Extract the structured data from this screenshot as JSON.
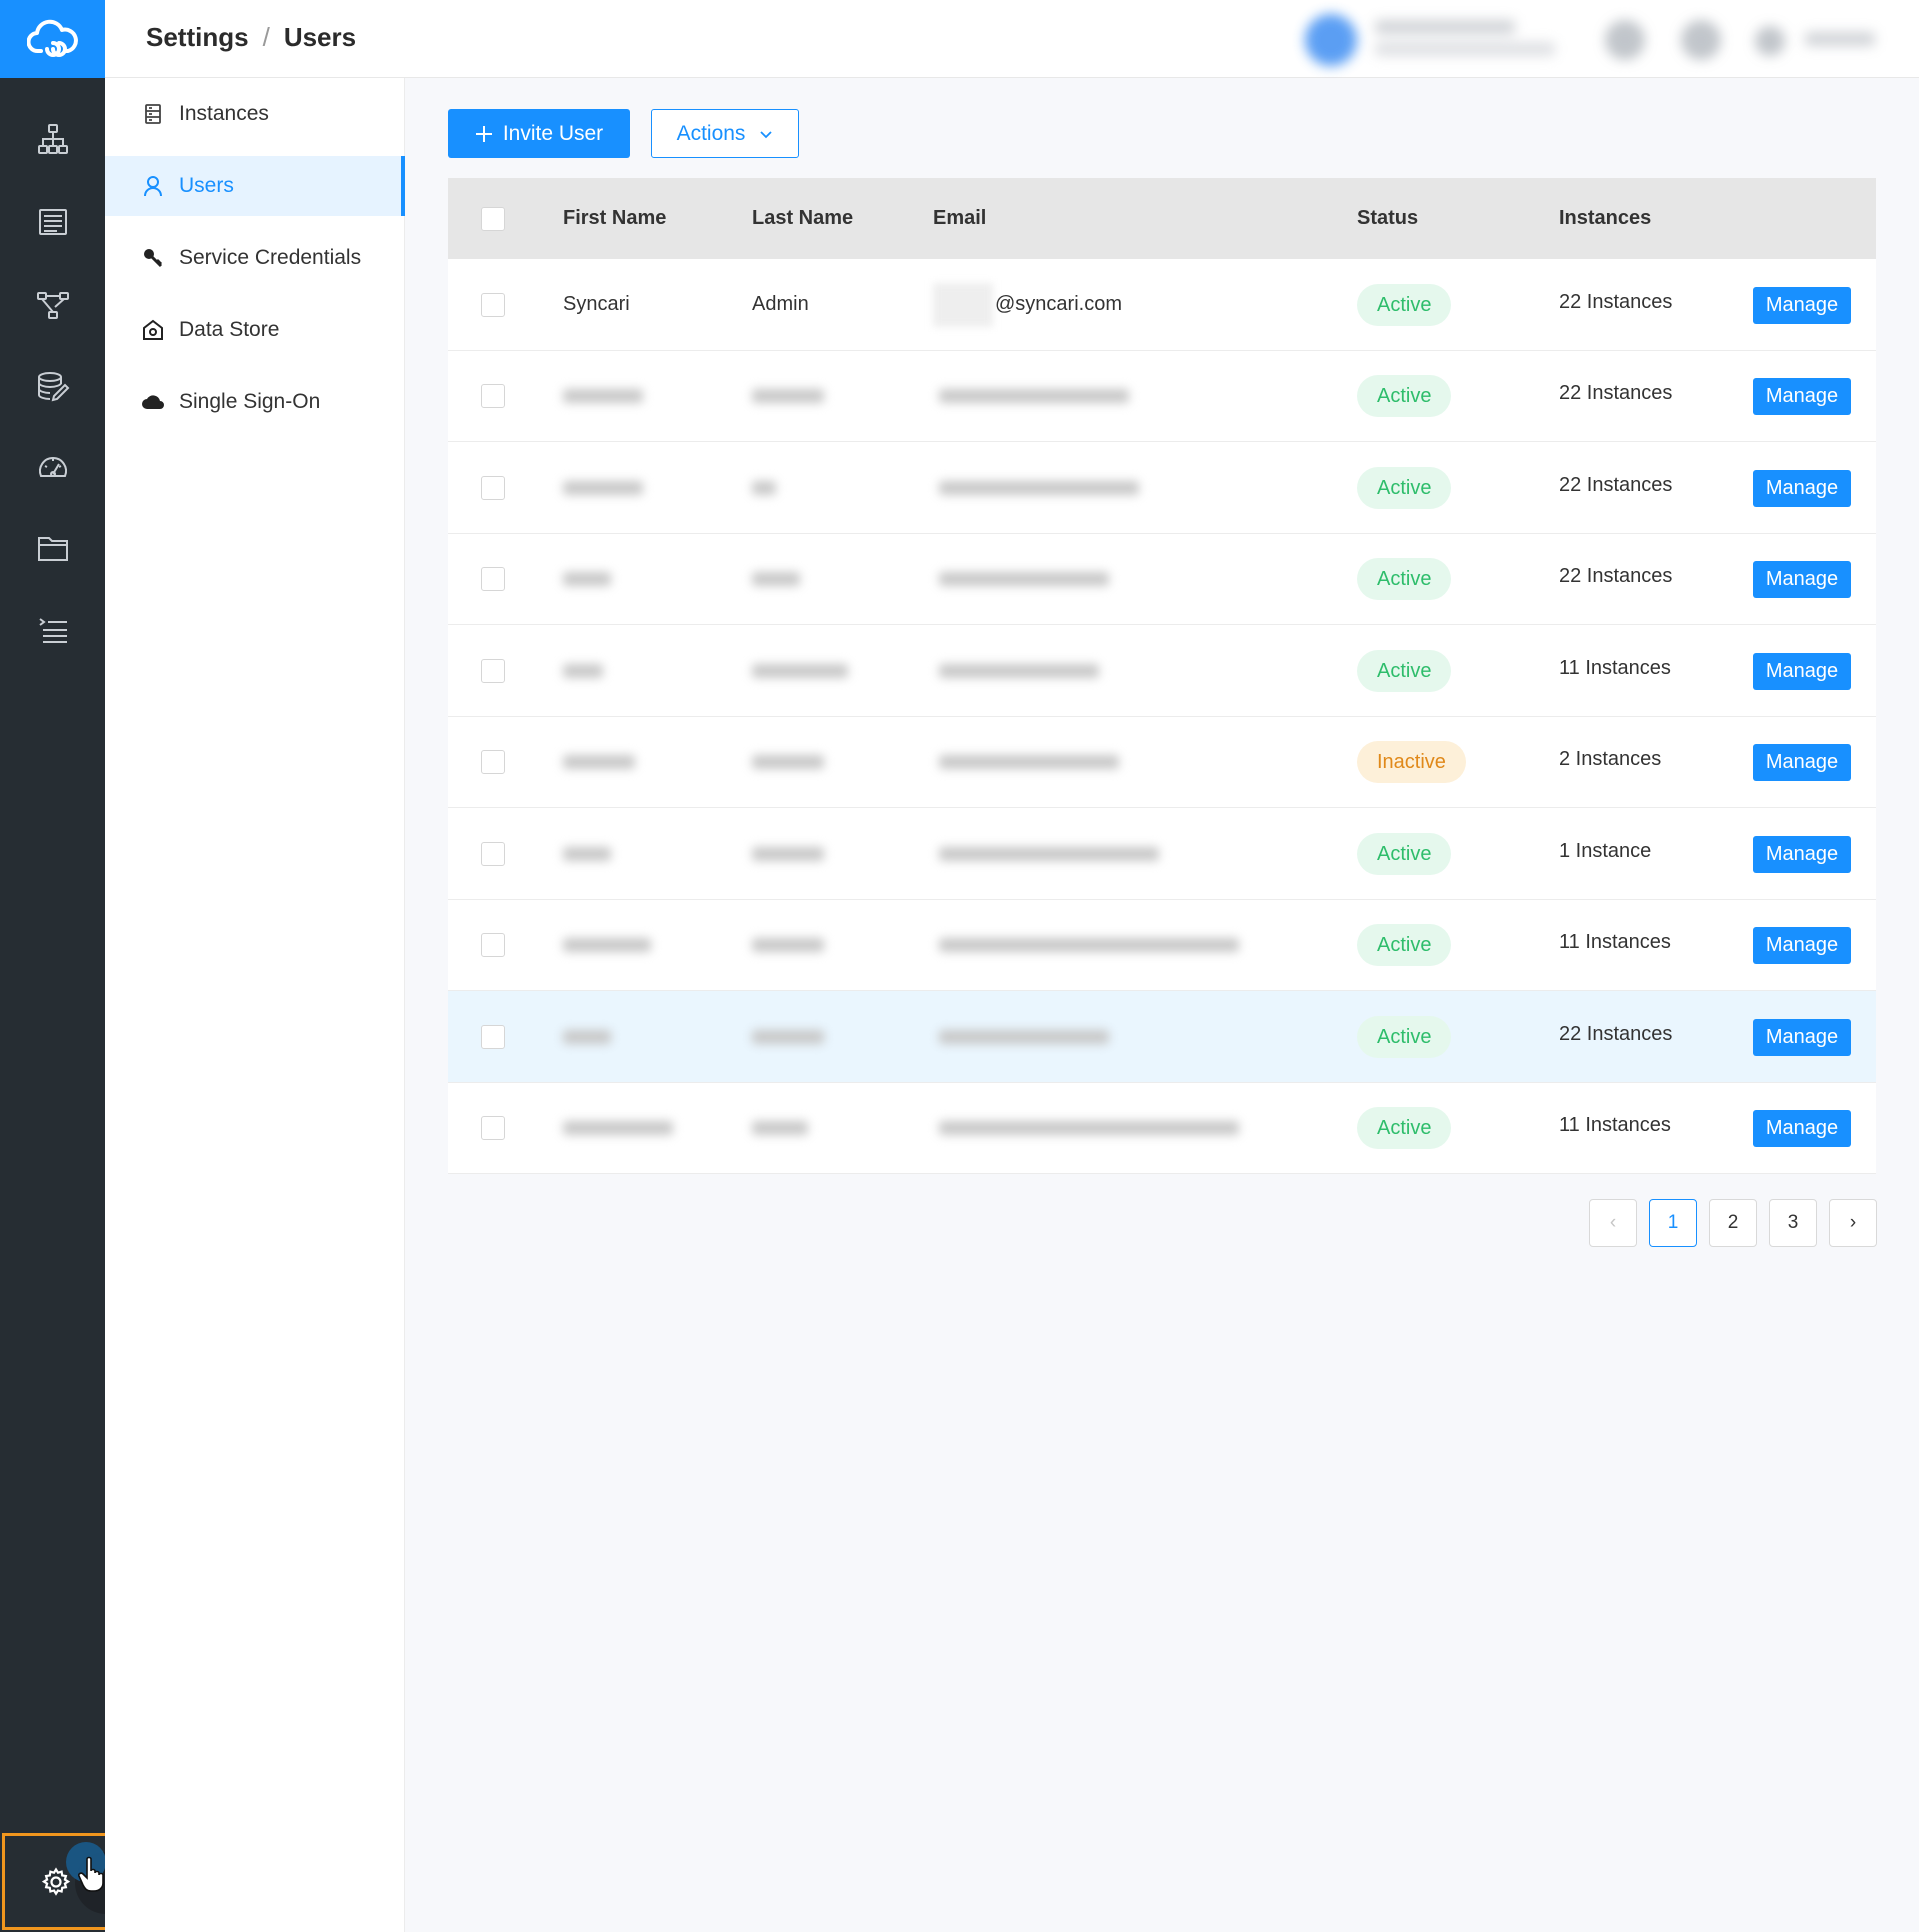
{
  "app": {
    "accent": "#1890ff",
    "rail_bg": "#262d33"
  },
  "breadcrumb": {
    "parent": "Settings",
    "separator": "/",
    "current": "Users"
  },
  "rail": {
    "items": [
      {
        "icon": "integration-graph-icon"
      },
      {
        "icon": "list-doc-icon"
      },
      {
        "icon": "flow-icon"
      },
      {
        "icon": "database-edit-icon"
      },
      {
        "icon": "dashboard-gauge-icon"
      },
      {
        "icon": "folder-icon"
      },
      {
        "icon": "indent-list-icon"
      }
    ],
    "settings_icon": "gear-icon"
  },
  "subnav": {
    "items": [
      {
        "label": "Instances",
        "icon": "server-icon",
        "active": false
      },
      {
        "label": "Users",
        "icon": "user-icon",
        "active": true
      },
      {
        "label": "Service Credentials",
        "icon": "key-icon",
        "active": false
      },
      {
        "label": "Data Store",
        "icon": "datastore-icon",
        "active": false
      },
      {
        "label": "Single Sign-On",
        "icon": "cloud-icon",
        "active": false
      }
    ]
  },
  "toolbar": {
    "invite_label": "Invite User",
    "actions_label": "Actions"
  },
  "table": {
    "headers": {
      "first_name": "First Name",
      "last_name": "Last Name",
      "email": "Email",
      "status": "Status",
      "instances": "Instances"
    },
    "manage_label": "Manage",
    "rows": [
      {
        "first": "Syncari",
        "last": "Admin",
        "email": "@syncari.com",
        "status": "Active",
        "instances": "22 Instances"
      },
      {
        "first": "",
        "last": "",
        "email": "",
        "status": "Active",
        "instances": "22 Instances"
      },
      {
        "first": "",
        "last": "",
        "email": "",
        "status": "Active",
        "instances": "22 Instances"
      },
      {
        "first": "",
        "last": "",
        "email": "",
        "status": "Active",
        "instances": "22 Instances"
      },
      {
        "first": "",
        "last": "",
        "email": "",
        "status": "Active",
        "instances": "11 Instances"
      },
      {
        "first": "",
        "last": "",
        "email": "",
        "status": "Inactive",
        "instances": "2 Instances"
      },
      {
        "first": "",
        "last": "",
        "email": "",
        "status": "Active",
        "instances": "1 Instance"
      },
      {
        "first": "",
        "last": "",
        "email": "",
        "status": "Active",
        "instances": "11 Instances"
      },
      {
        "first": "",
        "last": "",
        "email": "",
        "status": "Active",
        "instances": "22 Instances"
      },
      {
        "first": "",
        "last": "",
        "email": "",
        "status": "Active",
        "instances": "11 Instances"
      }
    ]
  },
  "pagination": {
    "prev": "‹",
    "pages": [
      "1",
      "2",
      "3"
    ],
    "current": "1",
    "next": "›"
  }
}
